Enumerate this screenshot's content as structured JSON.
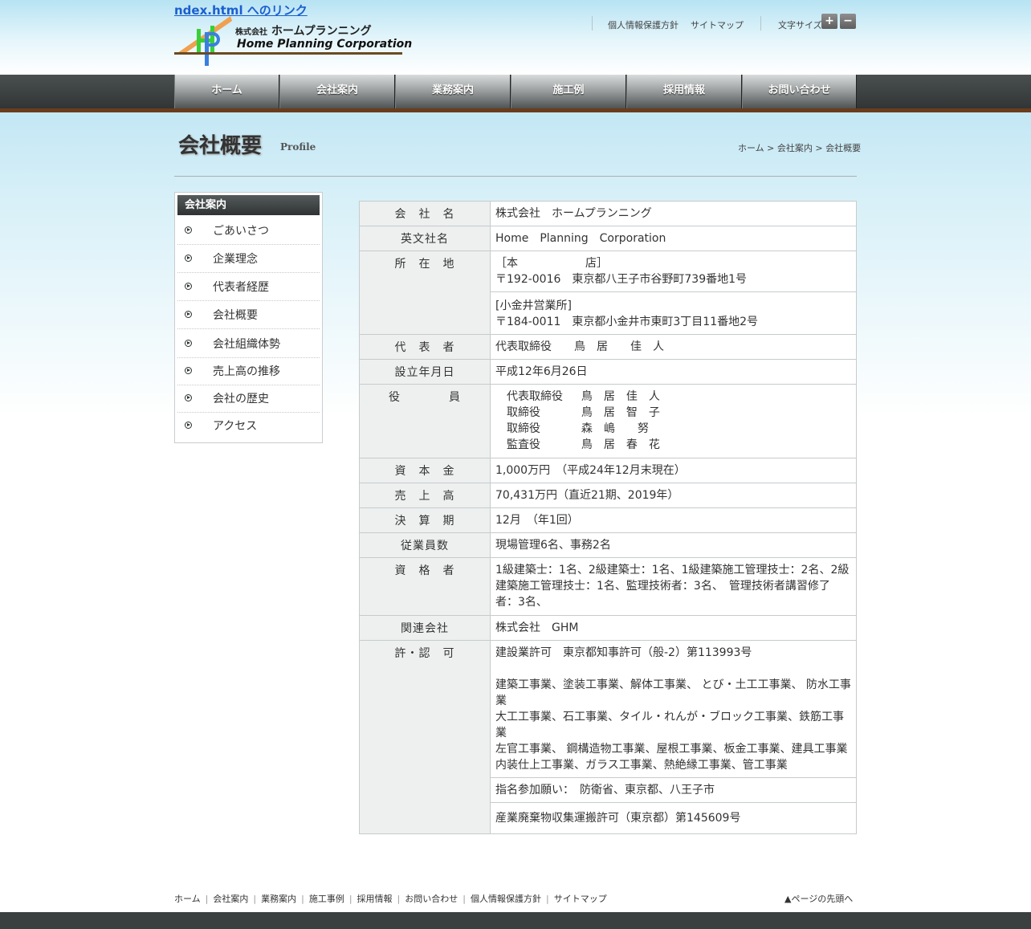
{
  "header": {
    "index_link": "ndex.html へのリンク",
    "logo_sub_prefix": "株式会社",
    "logo_sub_name": "ホームプランニング",
    "logo_en": "Home Planning Corporation",
    "privacy_link": "個人情報保護方針",
    "sitemap_link": "サイトマップ",
    "font_size_label": "文字サイズ",
    "font_plus": "+",
    "font_minus": "−"
  },
  "nav": {
    "items": [
      {
        "label": "ホーム"
      },
      {
        "label": "会社案内"
      },
      {
        "label": "業務案内"
      },
      {
        "label": "施工例"
      },
      {
        "label": "採用情報"
      },
      {
        "label": "お問い合わせ"
      }
    ]
  },
  "page": {
    "title": "会社概要",
    "subtitle": "Profile",
    "breadcrumb": "ホーム > 会社案内 > 会社概要"
  },
  "side": {
    "heading": "会社案内",
    "items": [
      {
        "label": "ごあいさつ"
      },
      {
        "label": "企業理念"
      },
      {
        "label": "代表者経歴"
      },
      {
        "label": "会社概要"
      },
      {
        "label": "会社組織体勢"
      },
      {
        "label": "売上高の推移"
      },
      {
        "label": "会社の歴史"
      },
      {
        "label": "アクセス"
      }
    ]
  },
  "profile": {
    "company_name": {
      "label": "会　社　名",
      "value": "株式会社　ホームプランニング"
    },
    "english_name": {
      "label": "英文社名",
      "value": "Home　Planning　Corporation"
    },
    "location": {
      "label": "所　在　地",
      "head_office_title": "［本　　　　　　店］",
      "head_office_address": "〒192-0016　東京都八王子市谷野町739番地1号",
      "branch_title": "[小金井営業所]",
      "branch_address": "〒184-0011　東京都小金井市東町3丁目11番地2号"
    },
    "representative": {
      "label": "代　表　者",
      "value": "代表取締役　　鳥　居　　佳　人"
    },
    "established": {
      "label": "設立年月日",
      "value": "平成12年6月26日"
    },
    "officers": {
      "label": "役　　　　員",
      "value": "　代表取締役　  鳥　居　佳　人\n　取締役　　　  鳥　居　智　子\n　取締役　　　  森　嶋　　努\n　監査役　　　  鳥　居　春　花"
    },
    "capital": {
      "label": "資　本　金",
      "value": "1,000万円　（平成24年12月末現在）"
    },
    "sales": {
      "label": "売　上　高",
      "value": "70,431万円（直近21期、2019年）"
    },
    "fiscal": {
      "label": "決　算　期",
      "value": "12月　（年1回）"
    },
    "employees": {
      "label": "従業員数",
      "value": "現場管理6名、事務2名"
    },
    "qualified": {
      "label": "資　格　者",
      "value": "1級建築士：1名、2級建築士：1名、1級建築施工管理技士：2名、2級建築施工管理技士：1名、監理技術者：3名、　管理技術者講習修了者：3名、"
    },
    "affiliate": {
      "label": "関連会社",
      "value": "株式会社　GHM"
    },
    "license": {
      "label": "許・認　可",
      "construction": "建設業許可　東京都知事許可（般-2）第113993号",
      "works_1": "建築工事業、塗装工事業、解体工事業、 とび・土工工事業、 防水工事業",
      "works_2": "大工工事業、石工事業、タイル・れんが・ブロック工事業、鉄筋工事業",
      "works_3": "左官工事業、 鋼構造物工事業、屋根工事業、板金工事業、建具工事業",
      "works_4": "内装仕上工事業、ガラス工事業、熱絶縁工事業、管工事業",
      "bid": "指名参加願い：　防衛省、東京都、八王子市",
      "waste": "産業廃棄物収集運搬許可（東京都）第145609号"
    }
  },
  "footer": {
    "links": [
      {
        "label": "ホーム"
      },
      {
        "label": "会社案内"
      },
      {
        "label": "業務案内"
      },
      {
        "label": "施工事例"
      },
      {
        "label": "採用情報"
      },
      {
        "label": "お問い合わせ"
      },
      {
        "label": "個人情報保護方針"
      },
      {
        "label": "サイトマップ"
      }
    ],
    "page_top": "▲ページの先頭へ"
  }
}
